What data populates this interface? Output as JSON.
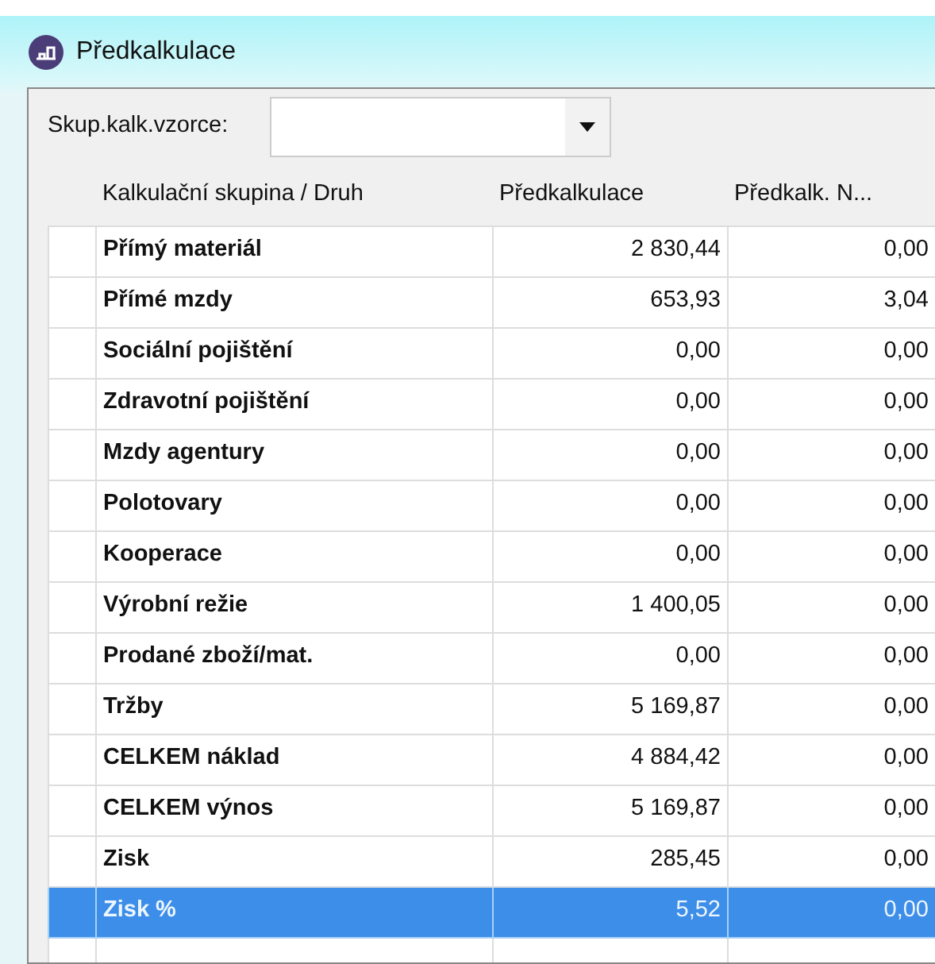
{
  "window": {
    "title": "Předkalkulace"
  },
  "filter": {
    "label": "Skup.kalk.vzorce:"
  },
  "table": {
    "columns": [
      "Kalkulační skupina / Druh",
      "Předkalkulace",
      "Předkalk. N..."
    ],
    "rows": [
      {
        "name": "Přímý materiál",
        "values": [
          "2 830,44",
          "0,00"
        ],
        "selected": false
      },
      {
        "name": "Přímé mzdy",
        "values": [
          "653,93",
          "3,04"
        ],
        "selected": false
      },
      {
        "name": "Sociální pojištění",
        "values": [
          "0,00",
          "0,00"
        ],
        "selected": false
      },
      {
        "name": "Zdravotní pojištění",
        "values": [
          "0,00",
          "0,00"
        ],
        "selected": false
      },
      {
        "name": "Mzdy agentury",
        "values": [
          "0,00",
          "0,00"
        ],
        "selected": false
      },
      {
        "name": "Polotovary",
        "values": [
          "0,00",
          "0,00"
        ],
        "selected": false
      },
      {
        "name": "Kooperace",
        "values": [
          "0,00",
          "0,00"
        ],
        "selected": false
      },
      {
        "name": "Výrobní režie",
        "values": [
          "1 400,05",
          "0,00"
        ],
        "selected": false
      },
      {
        "name": "Prodané zboží/mat.",
        "values": [
          "0,00",
          "0,00"
        ],
        "selected": false
      },
      {
        "name": "Tržby",
        "values": [
          "5 169,87",
          "0,00"
        ],
        "selected": false
      },
      {
        "name": "CELKEM náklad",
        "values": [
          "4 884,42",
          "0,00"
        ],
        "selected": false
      },
      {
        "name": "CELKEM výnos",
        "values": [
          "5 169,87",
          "0,00"
        ],
        "selected": false
      },
      {
        "name": "Zisk",
        "values": [
          "285,45",
          "0,00"
        ],
        "selected": false
      },
      {
        "name": "Zisk %",
        "values": [
          "5,52",
          "0,00"
        ],
        "selected": true
      }
    ]
  }
}
